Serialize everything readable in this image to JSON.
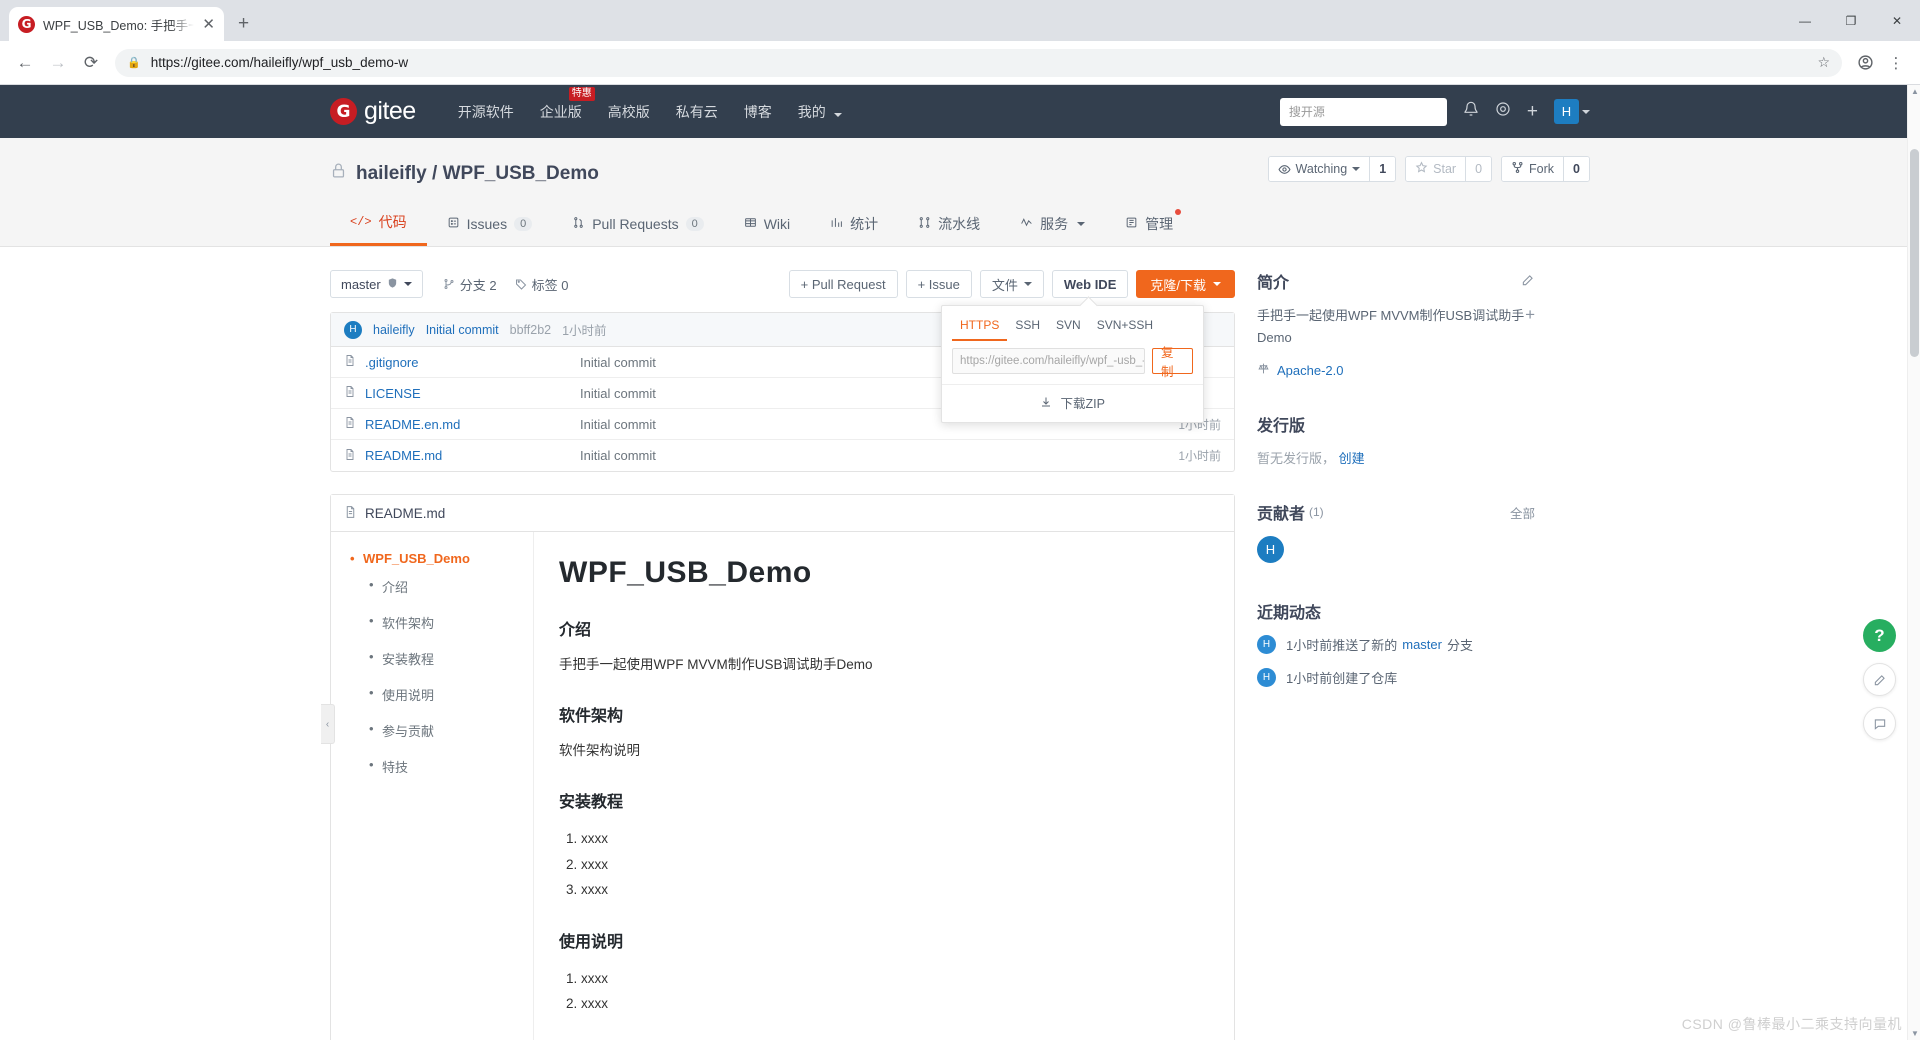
{
  "browser": {
    "tab": {
      "title": "WPF_USB_Demo: 手把手一起使",
      "favicon_letter": "G",
      "close_icon": "✕"
    },
    "new_tab_icon": "+",
    "window": {
      "minimize": "—",
      "maximize": "❐",
      "close": "✕"
    },
    "nav": {
      "back": "←",
      "forward": "→",
      "reload": "⟳"
    },
    "omnibox": {
      "lock_icon": "🔒",
      "url": "https://gitee.com/haileifly/wpf_usb_demo-w",
      "star_icon": "☆"
    },
    "profile_icon": "◓",
    "menu_icon": "⋮"
  },
  "gitee_nav": {
    "logo_letter": "G",
    "logo_text": "gitee",
    "links": [
      {
        "label": "开源软件",
        "badge": ""
      },
      {
        "label": "企业版",
        "badge": "特惠"
      },
      {
        "label": "高校版",
        "badge": ""
      },
      {
        "label": "私有云",
        "badge": ""
      },
      {
        "label": "博客",
        "badge": ""
      },
      {
        "label": "我的",
        "badge": "",
        "has_caret": true
      }
    ],
    "search_placeholder": "搜开源",
    "bell_icon": "🔔",
    "shield_icon": "◎",
    "plus_icon": "+",
    "avatar_letter": "H"
  },
  "repo": {
    "lock_icon": "🔒",
    "owner": "haileifly",
    "separator": "/",
    "name": "WPF_USB_Demo",
    "actions": [
      {
        "name": "watching",
        "icon": "👁",
        "label": "Watching",
        "caret": true,
        "count": "1",
        "disabled": false
      },
      {
        "name": "star",
        "icon": "☆",
        "label": "Star",
        "caret": false,
        "count": "0",
        "disabled": true
      },
      {
        "name": "fork",
        "icon": "⑂",
        "label": "Fork",
        "caret": false,
        "count": "0",
        "disabled": false
      }
    ],
    "tabs": [
      {
        "label": "代码",
        "icon": "</>",
        "count": "",
        "active": true,
        "dot": false
      },
      {
        "label": "Issues",
        "icon": "▤",
        "count": "0",
        "active": false,
        "dot": false
      },
      {
        "label": "Pull Requests",
        "icon": "⑂",
        "count": "0",
        "active": false,
        "dot": false
      },
      {
        "label": "Wiki",
        "icon": "▦",
        "count": "",
        "active": false,
        "dot": false
      },
      {
        "label": "统计",
        "icon": "▥",
        "count": "",
        "active": false,
        "dot": false
      },
      {
        "label": "流水线",
        "icon": "⑃",
        "count": "",
        "active": false,
        "dot": false
      },
      {
        "label": "服务",
        "icon": "∿",
        "count": "",
        "active": false,
        "dot": false,
        "caret": true
      },
      {
        "label": "管理",
        "icon": "▤",
        "count": "",
        "active": false,
        "dot": true
      }
    ]
  },
  "toolbar": {
    "branch": "master",
    "branch_shield_icon": "⬢",
    "branches_label": "分支 2",
    "branches_icon": "⑂",
    "tags_label": "标签 0",
    "tags_icon": "🏷",
    "pull_request_btn": "+ Pull Request",
    "issue_btn": "+ Issue",
    "files_btn": "文件",
    "webide_btn": "Web IDE",
    "clone_btn": "克隆/下载"
  },
  "clone_popover": {
    "tabs": [
      "HTTPS",
      "SSH",
      "SVN",
      "SVN+SSH"
    ],
    "active_tab": "HTTPS",
    "url_value": "https://gitee.com/haileifly/wpf_-usb_-d",
    "copy_label": "复制",
    "download_zip_label": "下载ZIP",
    "download_icon": "⤓"
  },
  "commit_bar": {
    "avatar_letter": "H",
    "author": "haileifly",
    "message": "Initial commit",
    "sha": "bbff2b2",
    "time": "1小时前"
  },
  "files": [
    {
      "icon": "▤",
      "name": ".gitignore",
      "commit": "Initial commit",
      "time": ""
    },
    {
      "icon": "▤",
      "name": "LICENSE",
      "commit": "Initial commit",
      "time": ""
    },
    {
      "icon": "▤",
      "name": "README.en.md",
      "commit": "Initial commit",
      "time": "1小时前"
    },
    {
      "icon": "▤",
      "name": "README.md",
      "commit": "Initial commit",
      "time": "1小时前"
    }
  ],
  "readme": {
    "file_icon": "▤",
    "filename": "README.md",
    "toc_top": "WPF_USB_Demo",
    "toc_items": [
      "介绍",
      "软件架构",
      "安装教程",
      "使用说明",
      "参与贡献",
      "特技"
    ],
    "collapse_icon": "‹",
    "h1": "WPF_USB_Demo",
    "sections": [
      {
        "heading": "介绍",
        "paragraph": "手把手一起使用WPF MVVM制作USB调试助手Demo",
        "list": []
      },
      {
        "heading": "软件架构",
        "paragraph": "软件架构说明",
        "list": []
      },
      {
        "heading": "安装教程",
        "paragraph": "",
        "list": [
          "xxxx",
          "xxxx",
          "xxxx"
        ]
      },
      {
        "heading": "使用说明",
        "paragraph": "",
        "list": [
          "xxxx",
          "xxxx"
        ]
      }
    ]
  },
  "sidebar": {
    "intro": {
      "title": "简介",
      "edit_icon": "✎",
      "text": "手把手一起使用WPF MVVM制作USB调试助手Demo",
      "add_icon": "+",
      "license_icon": "⚖",
      "license": "Apache-2.0"
    },
    "releases": {
      "title": "发行版",
      "empty_text": "暂无发行版，",
      "create_link": "创建"
    },
    "contributors": {
      "title": "贡献者",
      "count": "(1)",
      "all_label": "全部",
      "avatars": [
        "H"
      ]
    },
    "activity": {
      "title": "近期动态",
      "items": [
        {
          "avatar": "H",
          "text": "1小时前推送了新的",
          "link": "master",
          "suffix": "分支"
        },
        {
          "avatar": "H",
          "text": "1小时前创建了仓库",
          "link": "",
          "suffix": ""
        }
      ]
    }
  },
  "fabs": [
    {
      "name": "help",
      "icon": "?"
    },
    {
      "name": "feedback",
      "icon": "✑"
    },
    {
      "name": "chat",
      "icon": "☷"
    }
  ],
  "watermark": "CSDN @鲁棒最小二乘支持向量机"
}
